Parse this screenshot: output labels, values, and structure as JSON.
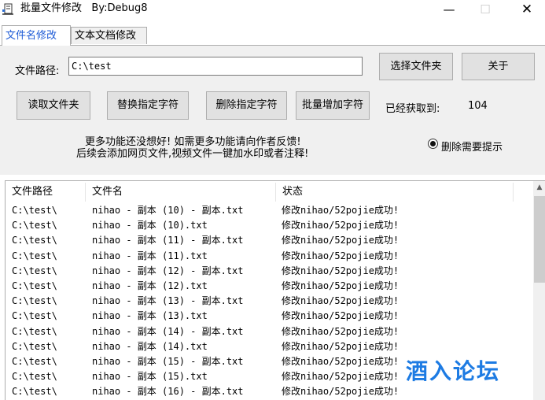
{
  "window": {
    "title": "批量文件修改   By:Debug8",
    "minimize_glyph": "—",
    "maximize_glyph": "☐",
    "close_glyph": "✕"
  },
  "tabs": [
    {
      "label": "文件名修改",
      "active": true
    },
    {
      "label": "文本文档修改",
      "active": false
    }
  ],
  "form": {
    "path_label": "文件路径:",
    "path_value": "C:\\test",
    "select_folder_button": "选择文件夹",
    "about_button": "关于",
    "read_folder_button": "读取文件夹",
    "replace_button": "替换指定字符",
    "delete_button": "删除指定字符",
    "add_button": "批量增加字符",
    "fetched_label": "已经获取到:",
    "fetched_count": "104",
    "notice_line1": "更多功能还没想好! 如需更多功能请向作者反馈!",
    "notice_line2": "后续会添加网页文件,视频文件一键加水印或者注释!",
    "radio_label": "删除需要提示",
    "radio_checked": true
  },
  "list": {
    "columns": [
      "文件路径",
      "文件名",
      "状态"
    ],
    "rows": [
      [
        "C:\\test\\",
        "nihao - 副本 (10) - 副本.txt",
        "修改nihao/52pojie成功!"
      ],
      [
        "C:\\test\\",
        "nihao - 副本 (10).txt",
        "修改nihao/52pojie成功!"
      ],
      [
        "C:\\test\\",
        "nihao - 副本 (11) - 副本.txt",
        "修改nihao/52pojie成功!"
      ],
      [
        "C:\\test\\",
        "nihao - 副本 (11).txt",
        "修改nihao/52pojie成功!"
      ],
      [
        "C:\\test\\",
        "nihao - 副本 (12) - 副本.txt",
        "修改nihao/52pojie成功!"
      ],
      [
        "C:\\test\\",
        "nihao - 副本 (12).txt",
        "修改nihao/52pojie成功!"
      ],
      [
        "C:\\test\\",
        "nihao - 副本 (13) - 副本.txt",
        "修改nihao/52pojie成功!"
      ],
      [
        "C:\\test\\",
        "nihao - 副本 (13).txt",
        "修改nihao/52pojie成功!"
      ],
      [
        "C:\\test\\",
        "nihao - 副本 (14) - 副本.txt",
        "修改nihao/52pojie成功!"
      ],
      [
        "C:\\test\\",
        "nihao - 副本 (14).txt",
        "修改nihao/52pojie成功!"
      ],
      [
        "C:\\test\\",
        "nihao - 副本 (15) - 副本.txt",
        "修改nihao/52pojie成功!"
      ],
      [
        "C:\\test\\",
        "nihao - 副本 (15).txt",
        "修改nihao/52pojie成功!"
      ],
      [
        "C:\\test\\",
        "nihao - 副本 (16) - 副本.txt",
        "修改nihao/52pojie成功!"
      ]
    ],
    "scroll_up_glyph": "▲"
  },
  "watermark": "酒入论坛",
  "colors": {
    "active_tab_text": "#1e5bd6",
    "watermark": "#1d7be3",
    "panel_bg": "#f0f0f0"
  }
}
